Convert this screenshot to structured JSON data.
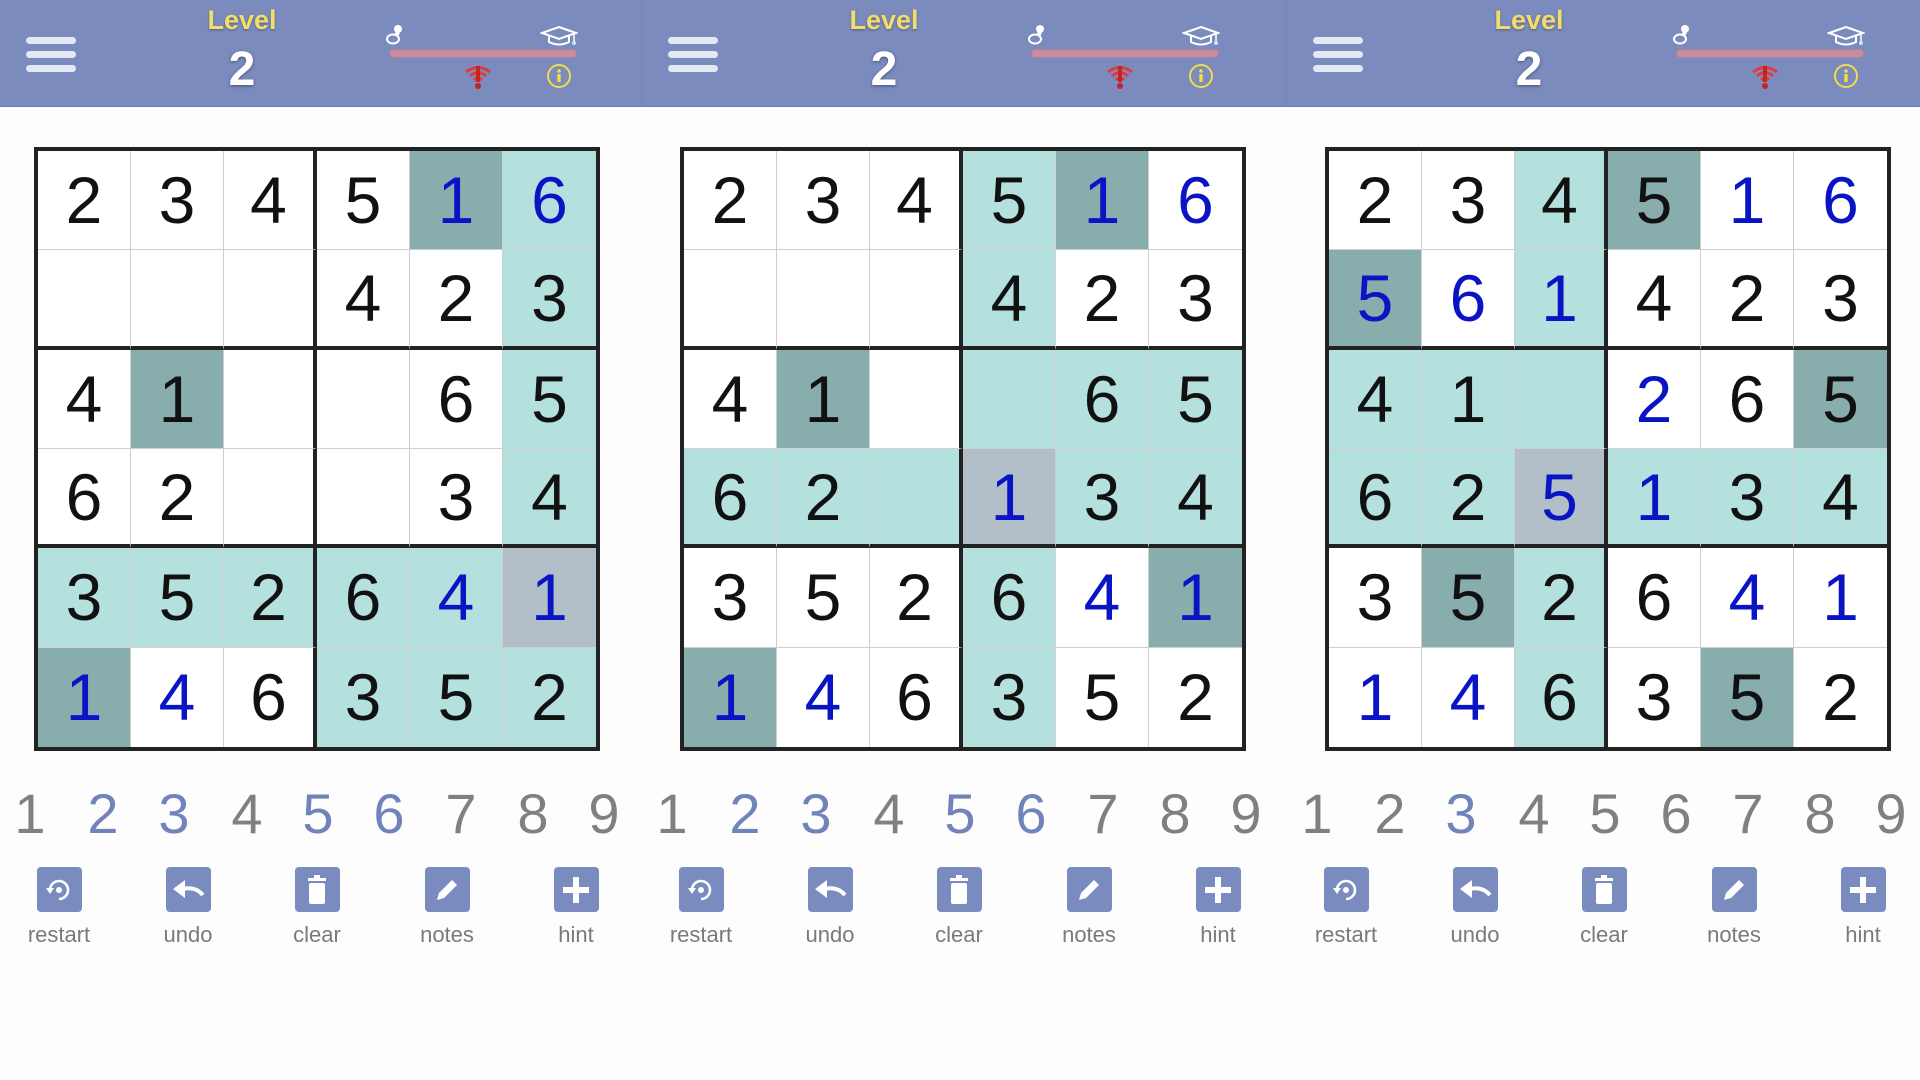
{
  "colors": {
    "header_bg": "#7b8bbd",
    "level_label": "#f2dc6a",
    "given_digit": "#111111",
    "user_digit": "#0a14c4",
    "highlight": "#b4e1dd",
    "same_value": "#87aeac",
    "selected": "#b2bfc8",
    "numpad_available": "#7183bb",
    "numpad_used": "#808080",
    "tool_icon_bg": "#7a8bc0"
  },
  "icons": {
    "menu": "hamburger-menu-icon",
    "easy": "pacifier-icon",
    "hard": "graduation-cap-icon",
    "warning": "warning-signal-icon",
    "info": "info-icon"
  },
  "toolbar": [
    {
      "label": "restart",
      "icon": "restart-icon"
    },
    {
      "label": "undo",
      "icon": "undo-icon"
    },
    {
      "label": "clear",
      "icon": "trash-icon"
    },
    {
      "label": "notes",
      "icon": "pencil-icon"
    },
    {
      "label": "hint",
      "icon": "plus-icon"
    }
  ],
  "numpad_digits": [
    "1",
    "2",
    "3",
    "4",
    "5",
    "6",
    "7",
    "8",
    "9"
  ],
  "panels": [
    {
      "level_label": "Level",
      "level_value": "2",
      "numpad_available": [
        false,
        true,
        true,
        false,
        true,
        true,
        false,
        false,
        false
      ],
      "grid": [
        [
          "2",
          "3",
          "4",
          "5",
          "1",
          "6"
        ],
        [
          "",
          "",
          "",
          "4",
          "2",
          "3"
        ],
        [
          "4",
          "1",
          "",
          "",
          "6",
          "5"
        ],
        [
          "6",
          "2",
          "",
          "",
          "3",
          "4"
        ],
        [
          "3",
          "5",
          "2",
          "6",
          "4",
          "1"
        ],
        [
          "1",
          "4",
          "6",
          "3",
          "5",
          "2"
        ]
      ],
      "user_entered": [
        [
          0,
          0,
          0,
          0,
          1,
          1
        ],
        [
          0,
          0,
          0,
          0,
          0,
          0
        ],
        [
          0,
          0,
          0,
          0,
          0,
          0
        ],
        [
          0,
          0,
          0,
          0,
          0,
          0
        ],
        [
          0,
          0,
          0,
          0,
          1,
          1
        ],
        [
          1,
          1,
          0,
          0,
          0,
          0
        ]
      ],
      "shading": [
        [
          "",
          "",
          "",
          "",
          "same",
          "hl"
        ],
        [
          "",
          "",
          "",
          "",
          "",
          "hl"
        ],
        [
          "",
          "same",
          "",
          "",
          "",
          "hl"
        ],
        [
          "",
          "",
          "",
          "",
          "",
          "hl"
        ],
        [
          "hl",
          "hl",
          "hl",
          "hl",
          "hl",
          "sel"
        ],
        [
          "same",
          "",
          "",
          "hl",
          "hl",
          "hl"
        ]
      ]
    },
    {
      "level_label": "Level",
      "level_value": "2",
      "numpad_available": [
        false,
        true,
        true,
        false,
        true,
        true,
        false,
        false,
        false
      ],
      "grid": [
        [
          "2",
          "3",
          "4",
          "5",
          "1",
          "6"
        ],
        [
          "",
          "",
          "",
          "4",
          "2",
          "3"
        ],
        [
          "4",
          "1",
          "",
          "",
          "6",
          "5"
        ],
        [
          "6",
          "2",
          "",
          "1",
          "3",
          "4"
        ],
        [
          "3",
          "5",
          "2",
          "6",
          "4",
          "1"
        ],
        [
          "1",
          "4",
          "6",
          "3",
          "5",
          "2"
        ]
      ],
      "user_entered": [
        [
          0,
          0,
          0,
          0,
          1,
          1
        ],
        [
          0,
          0,
          0,
          0,
          0,
          0
        ],
        [
          0,
          0,
          0,
          0,
          0,
          0
        ],
        [
          0,
          0,
          0,
          1,
          0,
          0
        ],
        [
          0,
          0,
          0,
          0,
          1,
          1
        ],
        [
          1,
          1,
          0,
          0,
          0,
          0
        ]
      ],
      "shading": [
        [
          "",
          "",
          "",
          "hl",
          "same",
          ""
        ],
        [
          "",
          "",
          "",
          "hl",
          "",
          ""
        ],
        [
          "",
          "same",
          "",
          "hl",
          "hl",
          "hl"
        ],
        [
          "hl",
          "hl",
          "hl",
          "sel",
          "hl",
          "hl"
        ],
        [
          "",
          "",
          "",
          "hl",
          "",
          "same"
        ],
        [
          "same",
          "",
          "",
          "hl",
          "",
          ""
        ]
      ]
    },
    {
      "level_label": "Level",
      "level_value": "2",
      "numpad_available": [
        false,
        false,
        true,
        false,
        false,
        false,
        false,
        false,
        false
      ],
      "grid": [
        [
          "2",
          "3",
          "4",
          "5",
          "1",
          "6"
        ],
        [
          "5",
          "6",
          "1",
          "4",
          "2",
          "3"
        ],
        [
          "4",
          "1",
          "",
          "2",
          "6",
          "5"
        ],
        [
          "6",
          "2",
          "5",
          "1",
          "3",
          "4"
        ],
        [
          "3",
          "5",
          "2",
          "6",
          "4",
          "1"
        ],
        [
          "1",
          "4",
          "6",
          "3",
          "5",
          "2"
        ]
      ],
      "user_entered": [
        [
          0,
          0,
          0,
          0,
          1,
          1
        ],
        [
          1,
          1,
          1,
          0,
          0,
          0
        ],
        [
          0,
          0,
          0,
          1,
          0,
          0
        ],
        [
          0,
          0,
          1,
          1,
          0,
          0
        ],
        [
          0,
          0,
          0,
          0,
          1,
          1
        ],
        [
          1,
          1,
          0,
          0,
          0,
          0
        ]
      ],
      "shading": [
        [
          "",
          "",
          "hl",
          "same",
          "",
          ""
        ],
        [
          "same",
          "",
          "hl",
          "",
          "",
          ""
        ],
        [
          "hl",
          "hl",
          "hl",
          "",
          "",
          "same"
        ],
        [
          "hl",
          "hl",
          "sel",
          "hl",
          "hl",
          "hl"
        ],
        [
          "",
          "same",
          "hl",
          "",
          "",
          ""
        ],
        [
          "",
          "",
          "hl",
          "",
          "same",
          ""
        ]
      ]
    }
  ]
}
